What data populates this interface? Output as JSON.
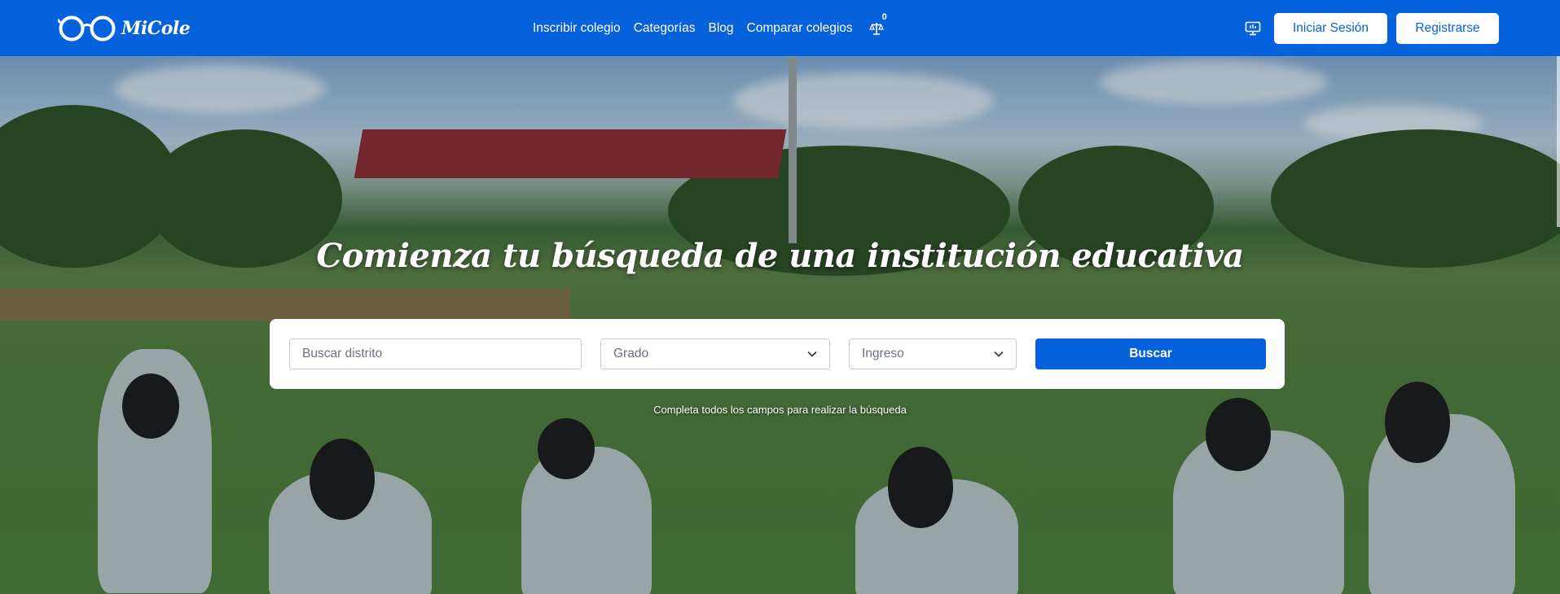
{
  "brand": {
    "name": "MiCole",
    "logo_icon": "glasses-icon"
  },
  "nav": {
    "links": [
      "Inscribir colegio",
      "Categorías",
      "Blog",
      "Comparar colegios"
    ],
    "compare_icon": "scale-icon",
    "compare_count": "0"
  },
  "header_actions": {
    "monitor_icon": "monitor-icon",
    "login_label": "Iniciar Sesión",
    "register_label": "Registrarse"
  },
  "hero": {
    "title": "Comienza tu búsqueda de una institución educativa",
    "background": "students-on-soccer-field-photo"
  },
  "search": {
    "district_placeholder": "Buscar distrito",
    "grade_value": "Grado",
    "entry_value": "Ingreso",
    "button_label": "Buscar",
    "hint": "Completa todos los campos para realizar la búsqueda"
  },
  "colors": {
    "primary": "#0662dc",
    "white": "#ffffff"
  }
}
